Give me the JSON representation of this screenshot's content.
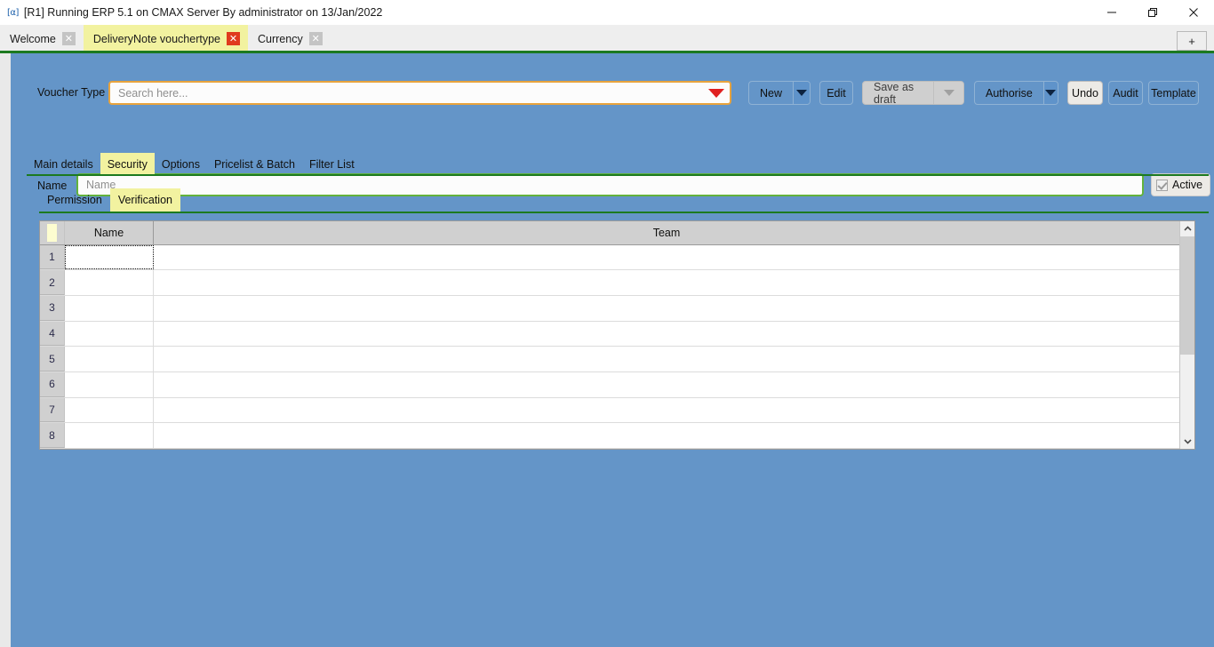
{
  "window": {
    "icon": "app-icon",
    "title": "[R1] Running ERP 5.1 on CMAX Server By administrator on 13/Jan/2022",
    "minimize_label": "minimize-icon",
    "restore_label": "restore-icon",
    "close_label": "close-icon"
  },
  "tabs": {
    "items": [
      {
        "label": "Welcome",
        "active": false,
        "close": "✕"
      },
      {
        "label": "DeliveryNote vouchertype",
        "active": true,
        "close": "✕"
      },
      {
        "label": "Currency",
        "active": false,
        "close": "✕"
      }
    ],
    "new_tab_label": "+"
  },
  "toolbar": {
    "voucher_type_label": "Voucher Type",
    "search_placeholder": "Search here...",
    "search_value": "",
    "new_label": "New",
    "edit_label": "Edit",
    "save_as_draft_label": "Save as draft",
    "authorise_label": "Authorise",
    "undo_label": "Undo",
    "audit_label": "Audit",
    "template_label": "Template"
  },
  "name_row": {
    "label": "Name",
    "placeholder": "Name",
    "value": "",
    "active_label": "Active",
    "active_checked": true
  },
  "main_tabs": [
    {
      "label": "Main details",
      "active": false
    },
    {
      "label": "Security",
      "active": true
    },
    {
      "label": "Options",
      "active": false
    },
    {
      "label": "Pricelist & Batch",
      "active": false
    },
    {
      "label": "Filter List",
      "active": false
    }
  ],
  "sub_tabs": [
    {
      "label": "Permission",
      "active": false
    },
    {
      "label": "Verification",
      "active": true
    }
  ],
  "grid": {
    "columns": [
      "Name",
      "Team"
    ],
    "rows": [
      {
        "num": "1",
        "name": "",
        "team": ""
      },
      {
        "num": "2",
        "name": "",
        "team": ""
      },
      {
        "num": "3",
        "name": "",
        "team": ""
      },
      {
        "num": "4",
        "name": "",
        "team": ""
      },
      {
        "num": "5",
        "name": "",
        "team": ""
      },
      {
        "num": "6",
        "name": "",
        "team": ""
      },
      {
        "num": "7",
        "name": "",
        "team": ""
      },
      {
        "num": "8",
        "name": "",
        "team": ""
      }
    ],
    "scroll_up": "⌃",
    "scroll_down": "⌄"
  },
  "colors": {
    "canvas_blue": "#6495c8",
    "accent_green": "#1c7a20",
    "tab_active_yellow": "#f2f2a0",
    "search_border_orange": "#e8a33d",
    "name_border_green": "#63b23c",
    "close_red": "#e03a1e"
  }
}
